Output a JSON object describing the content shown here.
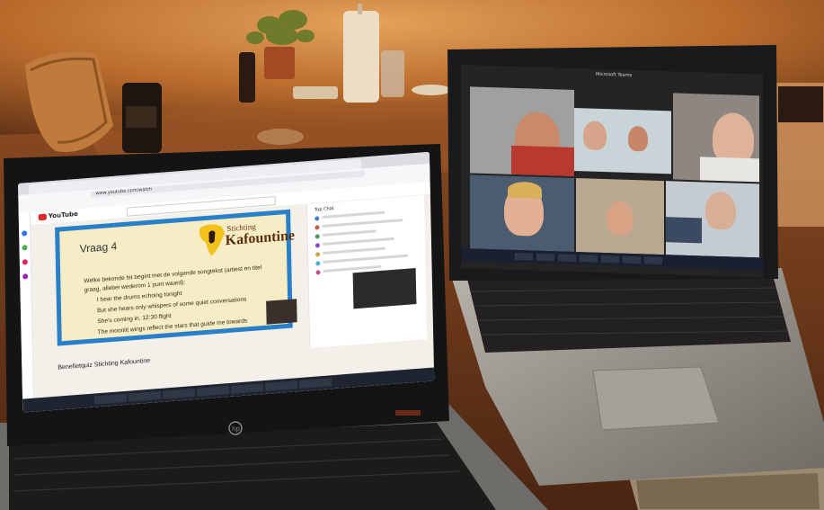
{
  "photo": {
    "subject": "two laptops on a table during an online quiz evening",
    "palette": {
      "wall": "#c9742e",
      "table": "#6a3a1c",
      "laptop_silver": "#8e8c88",
      "keyboard": "#1f1d1c",
      "slide_border": "#2a80c8",
      "slide_bg": "#f6ecc5",
      "brand": "#5b2e0c",
      "africa_map": "#f2c21b"
    }
  },
  "left_screen": {
    "browser": {
      "url": "www.youtube.com/watch"
    },
    "youtube": {
      "logo_text": "YouTube"
    },
    "slide": {
      "question_heading": "Vraag 4",
      "brand_line1": "Stichting",
      "brand_line2": "Kafountine",
      "lines": [
        "Welke bekende hit begint met de volgende songtekst (artiest en titel",
        "graag, allebei wederom 1 punt waard):",
        "I hear the drums echoing tonight",
        "But she hears only whispers of some quiet conversations",
        "She's coming in, 12:30 flight",
        "The moonlit wings reflect the stars that guide me towards"
      ]
    },
    "video_title": "Benefietquiz Stichting Kafountine",
    "chat_header": "Top Chat"
  },
  "right_screen": {
    "app_title": "Microsoft Teams",
    "participants": 7
  }
}
